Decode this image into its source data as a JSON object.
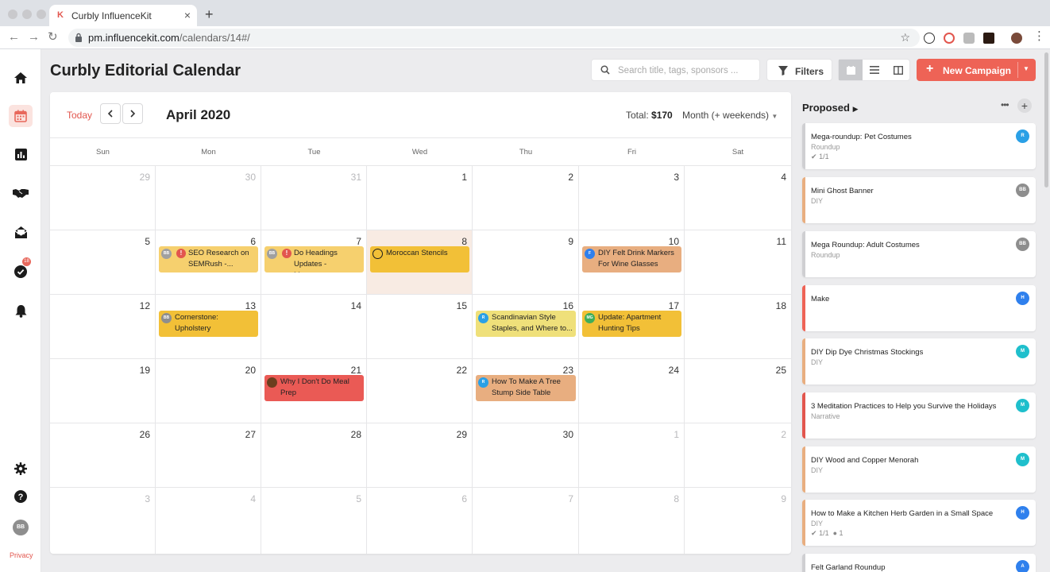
{
  "browser": {
    "tab_title": "Curbly InfluenceKit",
    "tab_favicon": "K",
    "url_host": "pm.influencekit.com",
    "url_path": "/calendars/14#/"
  },
  "sidebar": {
    "icons": [
      "home-icon",
      "calendar-icon",
      "bar-chart-icon",
      "handshake-icon",
      "envelope-open-icon",
      "check-circle-icon",
      "bell-icon"
    ],
    "task_badge": "18",
    "settings_icon": "gear-icon",
    "help_icon": "question-icon",
    "user_initials": "BB",
    "privacy": "Privacy"
  },
  "header": {
    "title": "Curbly Editorial Calendar",
    "search_placeholder": "Search title, tags, sponsors ...",
    "filters": "Filters",
    "new_campaign": "New Campaign"
  },
  "calendar": {
    "today": "Today",
    "month": "April 2020",
    "total_label": "Total:",
    "total_value": "$170",
    "view": "Month (+ weekends)",
    "weekdays": [
      "Sun",
      "Mon",
      "Tue",
      "Wed",
      "Thu",
      "Fri",
      "Sat"
    ],
    "weeks": [
      [
        {
          "d": "29",
          "dim": true
        },
        {
          "d": "30",
          "dim": true
        },
        {
          "d": "31",
          "dim": true
        },
        {
          "d": "1"
        },
        {
          "d": "2"
        },
        {
          "d": "3"
        },
        {
          "d": "4"
        }
      ],
      [
        {
          "d": "5"
        },
        {
          "d": "6"
        },
        {
          "d": "7"
        },
        {
          "d": "8",
          "today": true
        },
        {
          "d": "9"
        },
        {
          "d": "10"
        },
        {
          "d": "11"
        }
      ],
      [
        {
          "d": "12"
        },
        {
          "d": "13"
        },
        {
          "d": "14"
        },
        {
          "d": "15"
        },
        {
          "d": "16"
        },
        {
          "d": "17"
        },
        {
          "d": "18"
        }
      ],
      [
        {
          "d": "19"
        },
        {
          "d": "20"
        },
        {
          "d": "21"
        },
        {
          "d": "22"
        },
        {
          "d": "23"
        },
        {
          "d": "24"
        },
        {
          "d": "25"
        }
      ],
      [
        {
          "d": "26"
        },
        {
          "d": "27"
        },
        {
          "d": "28"
        },
        {
          "d": "29"
        },
        {
          "d": "30"
        },
        {
          "d": "1",
          "dim": true
        },
        {
          "d": "2",
          "dim": true
        }
      ],
      [
        {
          "d": "3",
          "dim": true
        },
        {
          "d": "4",
          "dim": true
        },
        {
          "d": "5",
          "dim": true
        },
        {
          "d": "6",
          "dim": true
        },
        {
          "d": "7",
          "dim": true
        },
        {
          "d": "8",
          "dim": true
        },
        {
          "d": "9",
          "dim": true
        }
      ]
    ],
    "events": [
      {
        "week": 1,
        "day": 1,
        "title": "SEO Research on SEMRush -...",
        "initials": "BB",
        "avatar_color": "#a0a0a0",
        "bg": "#f6d06e",
        "alert": true
      },
      {
        "week": 1,
        "day": 2,
        "title": "Do Headings Updates - Morocca...",
        "initials": "BB",
        "avatar_color": "#a0a0a0",
        "bg": "#f6d06e",
        "alert": true
      },
      {
        "week": 1,
        "day": 3,
        "title": "Moroccan Stencils",
        "initials": "",
        "avatar_color": "#f2c037",
        "bg": "#f2c037",
        "alert": false,
        "ring": true
      },
      {
        "week": 1,
        "day": 5,
        "title": "DIY Felt Drink Markers For Wine Glasses",
        "initials": "F",
        "avatar_color": "#2f80ed",
        "bg": "#e8ae80",
        "alert": false
      },
      {
        "week": 2,
        "day": 1,
        "title": "Cornerstone: Upholstery",
        "initials": "BB",
        "avatar_color": "#8e8e8e",
        "bg": "#f2c037",
        "alert": false
      },
      {
        "week": 2,
        "day": 4,
        "title": "Scandinavian Style Staples, and Where to...",
        "initials": "R",
        "avatar_color": "#2aa0e6",
        "bg": "#efe07a",
        "alert": false
      },
      {
        "week": 2,
        "day": 5,
        "title": "Update: Apartment Hunting Tips",
        "initials": "MG",
        "avatar_color": "#3fae5a",
        "bg": "#f2c037",
        "alert": false
      },
      {
        "week": 3,
        "day": 2,
        "title": "Why I Don't Do Meal Prep",
        "initials": "",
        "avatar_color": "#6b3e1e",
        "bg": "#ea5a55",
        "alert": false
      },
      {
        "week": 3,
        "day": 4,
        "title": "How To Make A Tree Stump Side Table",
        "initials": "R",
        "avatar_color": "#2aa0e6",
        "bg": "#e8ae80",
        "alert": false
      }
    ]
  },
  "proposed": {
    "title": "Proposed",
    "cards": [
      {
        "title": "Mega-roundup: Pet Costumes",
        "category": "Roundup",
        "meta": "1/1",
        "comments": "",
        "initials": "R",
        "avatar_color": "#2aa0e6",
        "stripe": "#cfcfd2"
      },
      {
        "title": "Mini Ghost Banner",
        "category": "DIY",
        "meta": "",
        "comments": "",
        "initials": "BB",
        "avatar_color": "#8e8e8e",
        "stripe": "#e8ae80"
      },
      {
        "title": "Mega Roundup: Adult Costumes",
        "category": "Roundup",
        "meta": "",
        "comments": "",
        "initials": "BB",
        "avatar_color": "#8e8e8e",
        "stripe": "#cfcfd2"
      },
      {
        "title": "Make",
        "category": "",
        "meta": "",
        "comments": "",
        "initials": "H",
        "avatar_color": "#2f80ed",
        "stripe": "#ee6356"
      },
      {
        "title": "DIY Dip Dye Christmas Stockings",
        "category": "DIY",
        "meta": "",
        "comments": "",
        "initials": "M",
        "avatar_color": "#1fbfcc",
        "stripe": "#e8ae80"
      },
      {
        "title": "3 Meditation Practices to Help you Survive the Holidays",
        "category": "Narrative",
        "meta": "",
        "comments": "",
        "initials": "M",
        "avatar_color": "#1fbfcc",
        "stripe": "#e2564e"
      },
      {
        "title": "DIY Wood and Copper Menorah",
        "category": "DIY",
        "meta": "",
        "comments": "",
        "initials": "M",
        "avatar_color": "#1fbfcc",
        "stripe": "#e8ae80"
      },
      {
        "title": "How to Make a Kitchen Herb Garden in a Small Space",
        "category": "DIY",
        "meta": "1/1",
        "comments": "1",
        "initials": "H",
        "avatar_color": "#2f80ed",
        "stripe": "#e8ae80"
      },
      {
        "title": "Felt Garland Roundup",
        "category": "",
        "meta": "",
        "comments": "",
        "initials": "A",
        "avatar_color": "#2f80ed",
        "stripe": "#cfcfd2"
      }
    ]
  }
}
